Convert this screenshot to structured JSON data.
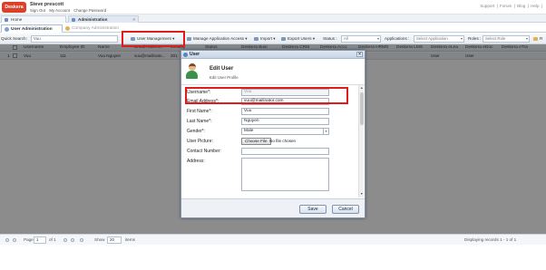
{
  "header": {
    "logo_text": "Deskera",
    "user_name": "Steve prescott",
    "user_links": [
      "Sign Out",
      "My Account",
      "Change Password"
    ],
    "top_links": [
      "Support",
      "|",
      "Forum",
      "|",
      "Blog",
      "|",
      "Help",
      "|"
    ]
  },
  "tabs": [
    {
      "label": "Home"
    },
    {
      "label": "Administration"
    }
  ],
  "subtabs": [
    {
      "label": "User Administration"
    },
    {
      "label": "Company Administration"
    }
  ],
  "toolbar": {
    "search_label": "Quick Search:",
    "search_value": "Vuu",
    "user_management": "User Management",
    "manage_access": "Manage Application Access",
    "import": "Import",
    "export_users": "Export Users",
    "status_label": "Status :",
    "status_value": "All",
    "applications_label": "Applications :",
    "applications_placeholder": "Select Application",
    "roles_label": "Roles :",
    "roles_placeholder": "Select Role",
    "reset_label": "R"
  },
  "grid": {
    "columns": [
      "Username",
      "Employee ID",
      "Name",
      "Email Address",
      "Locality",
      "Status",
      "Deskera Busi",
      "Deskera CRM",
      "Deskera Acco",
      "Deskera HRMS",
      "Deskera LMS",
      "Deskera eLea",
      "Deskera eDoc",
      "Deskera eTra"
    ],
    "rows": [
      {
        "num": "1",
        "username": "Vuu",
        "employee_id": "111",
        "name": "Vuu Nguyen",
        "email": "vuu@mailinato...",
        "locality": "201",
        "status": "",
        "d1": "",
        "d2": "",
        "d3": "",
        "d4": "",
        "d5": "",
        "d6": "User",
        "d7": "User"
      }
    ]
  },
  "dialog": {
    "title": "User",
    "close": "✕",
    "heading": "Edit User",
    "subheading": "Edit User Profile",
    "fields": {
      "username_label": "Username*:",
      "username_value": "Vuu",
      "email_label": "Email Address*:",
      "email_value": "vuu@mailinator.com",
      "first_name_label": "First Name*:",
      "first_name_value": "Vuu",
      "last_name_label": "Last Name*:",
      "last_name_value": "Nguyen",
      "gender_label": "Gender*:",
      "gender_value": "Male",
      "picture_label": "User Picture:",
      "choose_file": "Choose File",
      "no_file": "No file chosen",
      "contact_label": "Contact Number:",
      "contact_value": "",
      "address_label": "Address:"
    },
    "save": "Save",
    "cancel": "Cancel"
  },
  "footer": {
    "page_label": "Page",
    "page_value": "1",
    "of_label": "of 1",
    "show_label": "Show",
    "show_value": "20",
    "items_label": "items",
    "displaying": "Displaying records 1 - 1 of 1"
  },
  "colors": {
    "highlight": "#e21a1a",
    "brand": "#d9412b",
    "header_bg": "#dfe8f3"
  }
}
